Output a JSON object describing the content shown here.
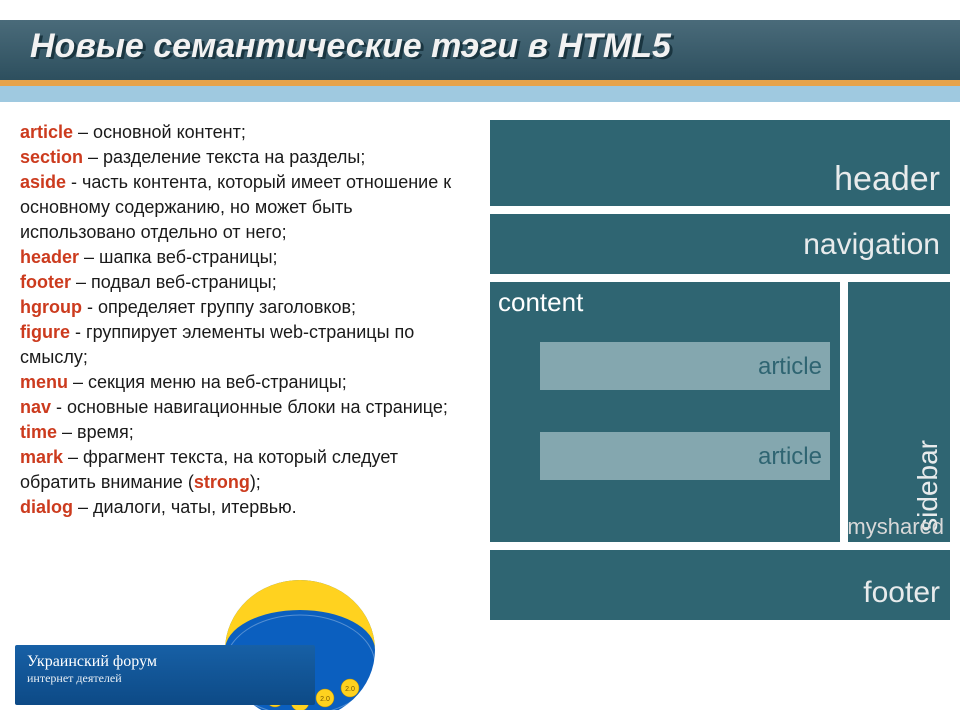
{
  "title": "Новые семантические тэги в HTML5",
  "tags": {
    "article": {
      "name": "article",
      "desc": " – основной контент;"
    },
    "section": {
      "name": "section",
      "desc": " – разделение текста на разделы;"
    },
    "aside": {
      "name": "aside",
      "desc": " - часть контента, который имеет отношение к основному содержанию, но может быть использовано отдельно от него;"
    },
    "header": {
      "name": "header",
      "desc": " – шапка веб-страницы;"
    },
    "footer": {
      "name": "footer",
      "desc": " – подвал веб-страницы;"
    },
    "hgroup": {
      "name": "hgroup",
      "desc": " - определяет группу заголовков;"
    },
    "figure": {
      "name": "figure",
      "desc": " - группирует элементы web-страницы по смыслу;"
    },
    "menu": {
      "name": "menu",
      "desc": " – секция меню на веб-страницы;"
    },
    "nav": {
      "name": "nav",
      "desc": " - основные навигационные блоки на странице;"
    },
    "time": {
      "name": "time",
      "desc": " – время;"
    },
    "mark": {
      "name": "mark",
      "desc_before": " – фрагмент текста, на который следует обратить внимание (",
      "desc_strong": "strong",
      "desc_after": ");"
    },
    "dialog": {
      "name": "dialog",
      "desc": " – диалоги, чаты, итервью."
    }
  },
  "diagram": {
    "header": "header",
    "navigation": "navigation",
    "content": "content",
    "article": "article",
    "sidebar": "sidebar",
    "footer": "footer"
  },
  "footer_brand": {
    "line1": "Украинский форум",
    "line2": "интернет деятелей"
  },
  "shared": "myshared"
}
